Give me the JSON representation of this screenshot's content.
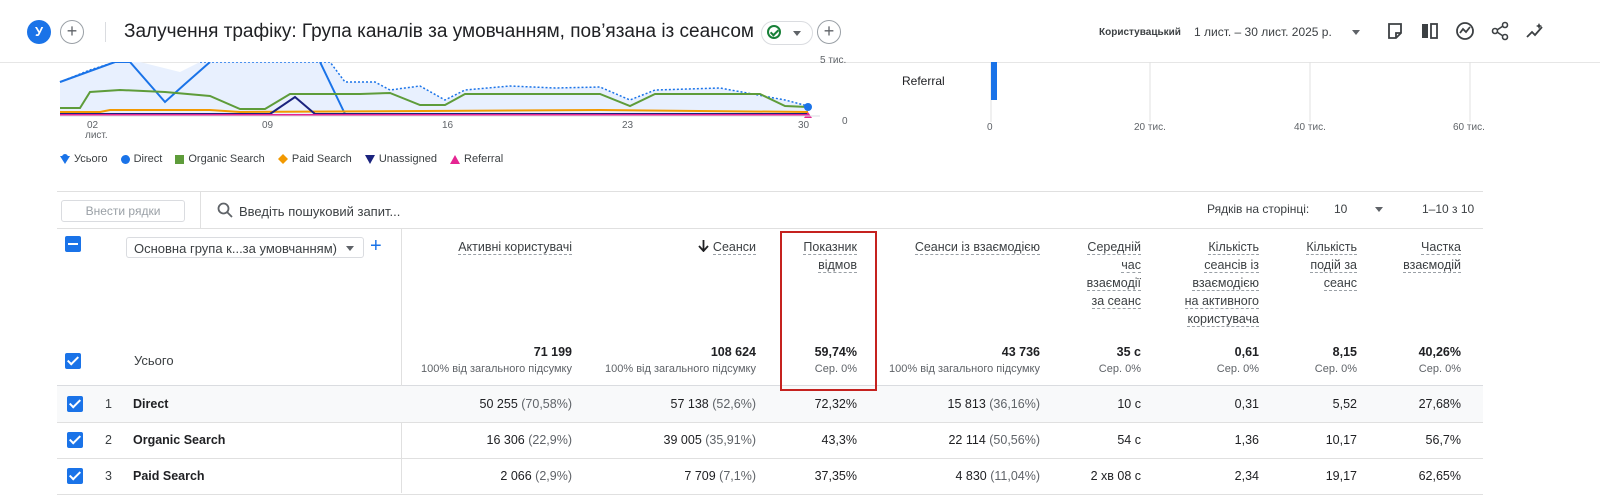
{
  "header": {
    "avatar_letter": "У",
    "title": "Залучення трафіку: Група каналів за умовчанням, пов’язана із сеансом",
    "date_type": "Користувацький",
    "date_range": "1 лист. – 30 лист. 2025 р."
  },
  "chart": {
    "y_tick_top": "5 тис.",
    "y_tick_zero": "0",
    "x_ticks": [
      "02",
      "09",
      "16",
      "23",
      "30"
    ],
    "x_tick_sub": "лист.",
    "bar_category": "Referral",
    "bar_x_ticks": [
      "0",
      "20 тис.",
      "40 тис.",
      "60 тис."
    ],
    "legend": [
      {
        "label": "Усього",
        "color": "#1a73e8",
        "shape": "pin"
      },
      {
        "label": "Direct",
        "color": "#1a73e8",
        "shape": "circle"
      },
      {
        "label": "Organic Search",
        "color": "#5e9c3a",
        "shape": "square"
      },
      {
        "label": "Paid Search",
        "color": "#f29900",
        "shape": "diamond"
      },
      {
        "label": "Unassigned",
        "color": "#1a237e",
        "shape": "triangle-down"
      },
      {
        "label": "Referral",
        "color": "#e52592",
        "shape": "triangle-up"
      }
    ]
  },
  "toolbar": {
    "insert_rows": "Внести рядки",
    "search_placeholder": "Введіть пошуковий запит...",
    "rows_per_page_label": "Рядків на сторінці:",
    "rows_per_page_value": "10",
    "pager": "1–10 з 10"
  },
  "table": {
    "dimension_select": "Основна група к...за умовчанням)",
    "columns": {
      "active_users": "Активні користувачі",
      "sessions": "Сеанси",
      "bounce_rate": [
        "Показник",
        "відмов"
      ],
      "engaged_sessions": "Сеанси із взаємодією",
      "avg_time": [
        "Середній",
        "час",
        "взаємодії",
        "за сеанс"
      ],
      "engaged_per_user": [
        "Кількість",
        "сеансів із",
        "взаємодією",
        "на активного",
        "користувача"
      ],
      "events_per_session": [
        "Кількість",
        "подій за",
        "сеанс"
      ],
      "engagement_rate": [
        "Частка",
        "взаємодій"
      ]
    },
    "totals": {
      "label": "Усього",
      "active_users": "71 199",
      "active_users_sub": "100% від загального підсумку",
      "sessions": "108 624",
      "sessions_sub": "100% від загального підсумку",
      "bounce_rate": "59,74%",
      "bounce_rate_sub": "Сер. 0%",
      "engaged_sessions": "43 736",
      "engaged_sessions_sub": "100% від загального підсумку",
      "avg_time": "35 с",
      "avg_time_sub": "Сер. 0%",
      "engaged_per_user": "0,61",
      "engaged_per_user_sub": "Сер. 0%",
      "events_per_session": "8,15",
      "events_per_session_sub": "Сер. 0%",
      "engagement_rate": "40,26%",
      "engagement_rate_sub": "Сер. 0%"
    },
    "rows": [
      {
        "n": "1",
        "label": "Direct",
        "active_users": "50 255",
        "active_users_pct": "(70,58%)",
        "sessions": "57 138",
        "sessions_pct": "(52,6%)",
        "bounce_rate": "72,32%",
        "engaged_sessions": "15 813",
        "engaged_sessions_pct": "(36,16%)",
        "avg_time": "10 с",
        "engaged_per_user": "0,31",
        "events_per_session": "5,52",
        "engagement_rate": "27,68%"
      },
      {
        "n": "2",
        "label": "Organic Search",
        "active_users": "16 306",
        "active_users_pct": "(22,9%)",
        "sessions": "39 005",
        "sessions_pct": "(35,91%)",
        "bounce_rate": "43,3%",
        "engaged_sessions": "22 114",
        "engaged_sessions_pct": "(50,56%)",
        "avg_time": "54 с",
        "engaged_per_user": "1,36",
        "events_per_session": "10,17",
        "engagement_rate": "56,7%"
      },
      {
        "n": "3",
        "label": "Paid Search",
        "active_users": "2 066",
        "active_users_pct": "(2,9%)",
        "sessions": "7 709",
        "sessions_pct": "(7,1%)",
        "bounce_rate": "37,35%",
        "engaged_sessions": "4 830",
        "engaged_sessions_pct": "(11,04%)",
        "avg_time": "2 хв 08 с",
        "engaged_per_user": "2,34",
        "events_per_session": "19,17",
        "engagement_rate": "62,65%"
      }
    ]
  }
}
